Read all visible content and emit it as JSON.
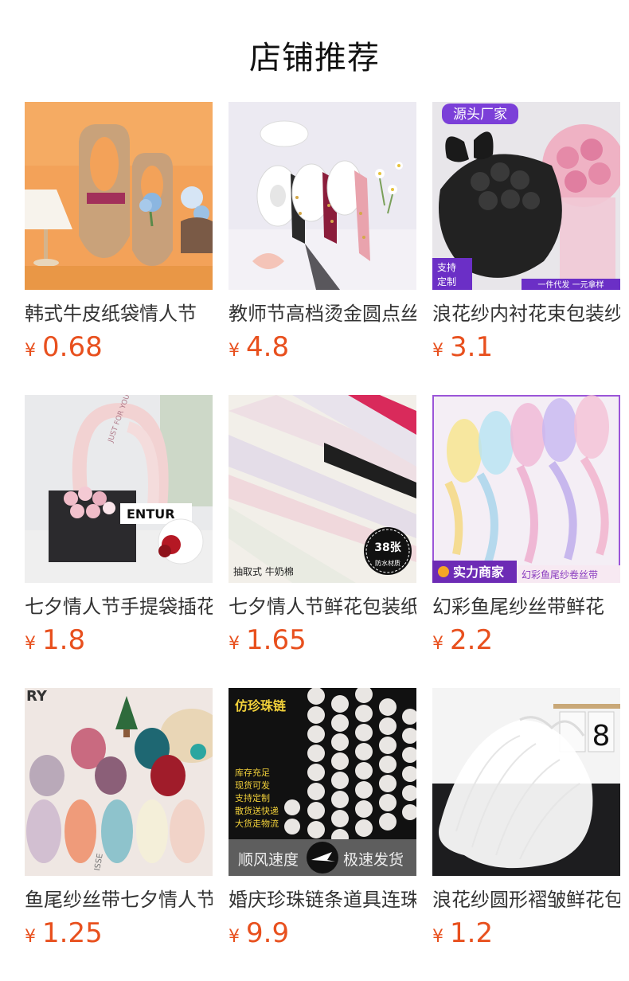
{
  "header": {
    "title": "店铺推荐"
  },
  "currency_symbol": "¥",
  "products": [
    {
      "title": "韩式牛皮纸袋情人节",
      "price": "0.68",
      "image": "kraft-paper-bag-bouquet"
    },
    {
      "title": "教师节高档烫金圆点丝带",
      "price": "4.8",
      "image": "gold-dot-ribbon-rolls"
    },
    {
      "title": "浪花纱内衬花束包装纱",
      "price": "3.1",
      "image": "black-rose-bouquet",
      "badges": {
        "top": "源头厂家",
        "corner_line1": "支持",
        "corner_line2": "定制",
        "bottom": "一件代发 一元拿样"
      }
    },
    {
      "title": "七夕情人节手提袋插花",
      "price": "1.8",
      "image": "handheld-flower-bag",
      "badges": {
        "bag_text": "JUST FOR YOU",
        "sign": "ENTUR"
      }
    },
    {
      "title": "七夕情人节鲜花包装纸",
      "price": "1.65",
      "image": "wrapping-paper-sheets",
      "badges": {
        "count": "38张",
        "circle_sub": "防水材质",
        "caption": "抽取式 牛奶棉"
      }
    },
    {
      "title": "幻彩鱼尾纱丝带鲜花",
      "price": "2.2",
      "image": "iridescent-ribbon",
      "badges": {
        "shop": "实力商家",
        "bottom": "幻彩鱼尾纱卷丝带"
      }
    },
    {
      "title": "鱼尾纱丝带七夕情人节",
      "price": "1.25",
      "image": "fishtail-ribbon-rolls",
      "badges": {
        "corner": "RY"
      }
    },
    {
      "title": "婚庆珍珠链条道具连珠",
      "price": "9.9",
      "image": "pearl-chains",
      "badges": {
        "head": "仿珍珠链",
        "features": [
          "库存充足",
          "现货可发",
          "支持定制",
          "散货送快递",
          "大货走物流"
        ],
        "left": "顺风速度",
        "right": "极速发货"
      }
    },
    {
      "title": "浪花纱圆形褶皱鲜花包装",
      "price": "1.2",
      "image": "white-ruffle-mesh",
      "badges": {
        "digit": "8"
      }
    }
  ],
  "colors": {
    "price": "#e8501e",
    "title": "#333333",
    "heading": "#111111"
  }
}
